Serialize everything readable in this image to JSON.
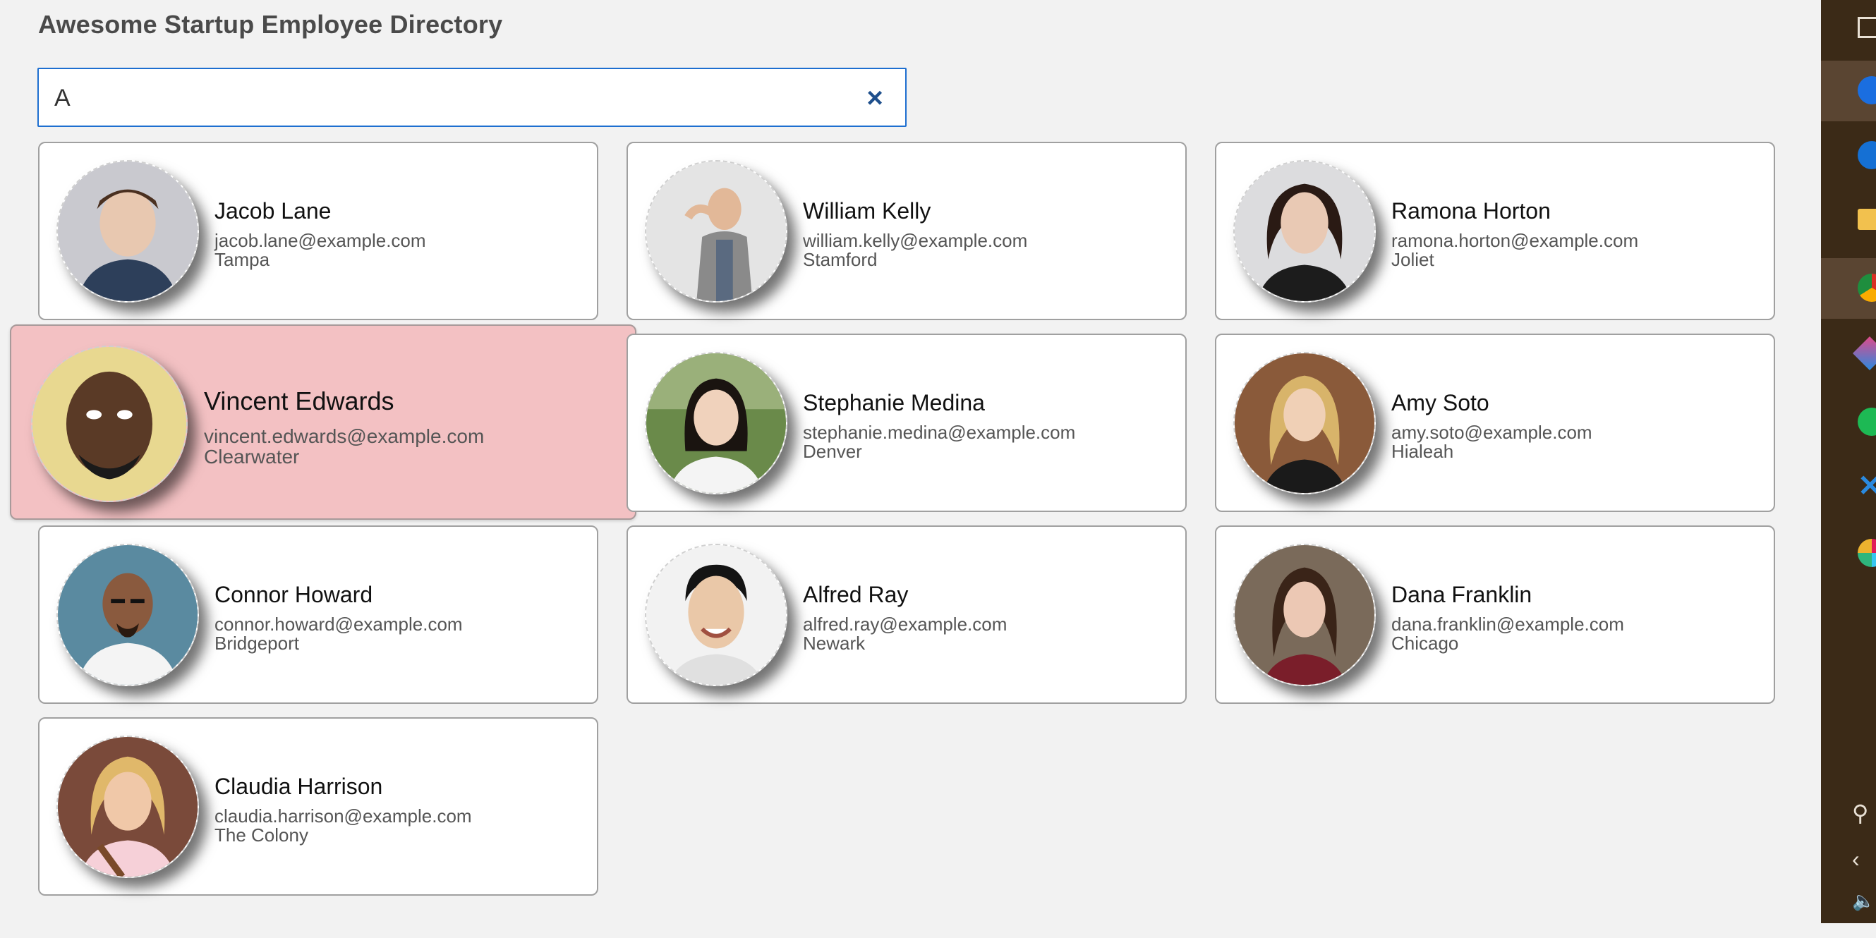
{
  "app": {
    "title": "Awesome Startup Employee Directory"
  },
  "search": {
    "value": "A",
    "clear_label": "×"
  },
  "employees": [
    {
      "name": "Jacob Lane",
      "email": "jacob.lane@example.com",
      "city": "Tampa"
    },
    {
      "name": "William Kelly",
      "email": "william.kelly@example.com",
      "city": "Stamford"
    },
    {
      "name": "Ramona Horton",
      "email": "ramona.horton@example.com",
      "city": "Joliet"
    },
    {
      "name": "Vincent Edwards",
      "email": "vincent.edwards@example.com",
      "city": "Clearwater"
    },
    {
      "name": "Stephanie Medina",
      "email": "stephanie.medina@example.com",
      "city": "Denver"
    },
    {
      "name": "Amy Soto",
      "email": "amy.soto@example.com",
      "city": "Hialeah"
    },
    {
      "name": "Connor Howard",
      "email": "connor.howard@example.com",
      "city": "Bridgeport"
    },
    {
      "name": "Alfred Ray",
      "email": "alfred.ray@example.com",
      "city": "Newark"
    },
    {
      "name": "Dana Franklin",
      "email": "dana.franklin@example.com",
      "city": "Chicago"
    },
    {
      "name": "Claudia Harrison",
      "email": "claudia.harrison@example.com",
      "city": "The Colony"
    }
  ],
  "taskbar": {
    "icons": [
      "window-icon",
      "firefox-icon",
      "edge-icon",
      "file-explorer-icon",
      "chrome-icon",
      "paint-icon",
      "spotify-icon",
      "vscode-icon",
      "slack-icon",
      "people-icon",
      "chevron-left-icon",
      "volume-icon"
    ]
  },
  "colors": {
    "highlight": "#f3c1c3",
    "search_border": "#1e6fd0",
    "taskbar": "#3b2a17"
  }
}
